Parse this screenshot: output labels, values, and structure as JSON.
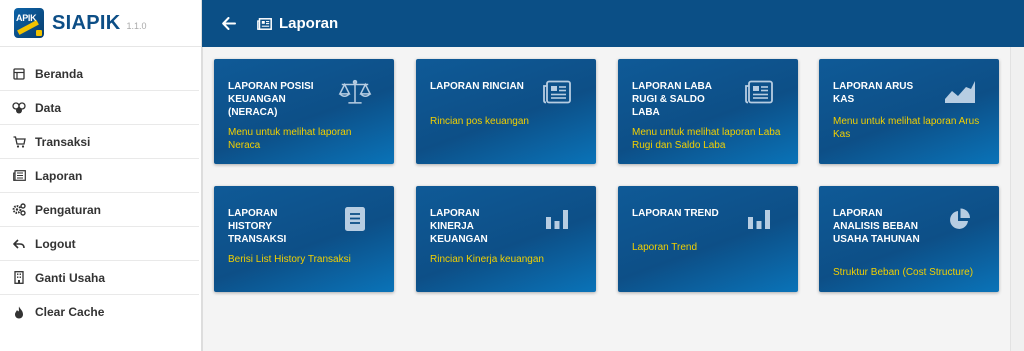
{
  "app": {
    "logo_text": "APIK",
    "name": "SIAPIK",
    "version": "1.1.0"
  },
  "header": {
    "title": "Laporan"
  },
  "sidebar": {
    "items": [
      {
        "label": "Beranda",
        "icon": "home-icon"
      },
      {
        "label": "Data",
        "icon": "data-icon"
      },
      {
        "label": "Transaksi",
        "icon": "cart-icon"
      },
      {
        "label": "Laporan",
        "icon": "report-icon"
      },
      {
        "label": "Pengaturan",
        "icon": "gears-icon"
      },
      {
        "label": "Logout",
        "icon": "logout-icon"
      },
      {
        "label": "Ganti Usaha",
        "icon": "building-icon"
      },
      {
        "label": "Clear Cache",
        "icon": "fire-icon"
      }
    ]
  },
  "cards": [
    {
      "title": "LAPORAN POSISI KEUANGAN (NERACA)",
      "desc": "Menu untuk melihat laporan Neraca",
      "icon": "balance-scale-icon"
    },
    {
      "title": "LAPORAN RINCIAN",
      "desc": "Rincian pos keuangan",
      "icon": "newspaper-icon"
    },
    {
      "title": "LAPORAN LABA RUGI & SALDO LABA",
      "desc": "Menu untuk melihat laporan Laba Rugi dan Saldo Laba",
      "icon": "newspaper-icon"
    },
    {
      "title": "LAPORAN ARUS KAS",
      "desc": "Menu untuk melihat laporan Arus Kas",
      "icon": "area-chart-icon"
    },
    {
      "title": "LAPORAN HISTORY TRANSAKSI",
      "desc": "Berisi List History Transaksi",
      "icon": "document-icon"
    },
    {
      "title": "LAPORAN KINERJA KEUANGAN",
      "desc": "Rincian Kinerja keuangan",
      "icon": "bar-chart-icon"
    },
    {
      "title": "LAPORAN TREND",
      "desc": "Laporan Trend",
      "icon": "bar-chart-icon"
    },
    {
      "title": "LAPORAN ANALISIS BEBAN USAHA TAHUNAN",
      "desc": "Struktur Beban (Cost Structure)",
      "icon": "pie-chart-icon"
    }
  ],
  "colors": {
    "header_bg": "#0b4f86",
    "card_bg": "#0d4f87",
    "card_desc": "#f2d000",
    "brand": "#0d4e86"
  }
}
